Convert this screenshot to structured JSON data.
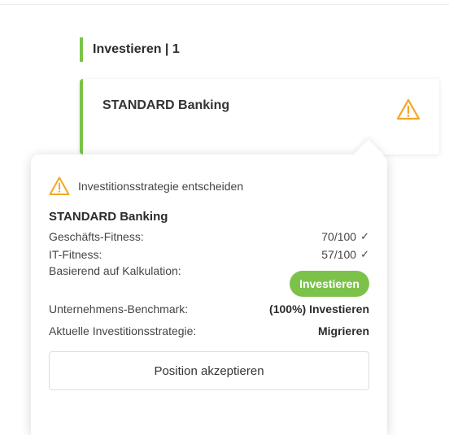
{
  "section": {
    "header": "Investieren | 1"
  },
  "card": {
    "title": "STANDARD Banking",
    "warning_icon": "warning-triangle-icon"
  },
  "popover": {
    "header": "Investitionsstrategie entscheiden",
    "title": "STANDARD Banking",
    "business_fitness_label": "Geschäfts-Fitness:",
    "business_fitness_value": "70/100",
    "it_fitness_label": "IT-Fitness:",
    "it_fitness_value": "57/100",
    "check_glyph": "✓",
    "basis_label": "Basierend auf Kalkulation:",
    "basis_value": "Investieren",
    "benchmark_label": "Unternehmens-Benchmark:",
    "benchmark_value": "(100%) Investieren",
    "current_strategy_label": "Aktuelle Investitionsstrategie:",
    "current_strategy_value": "Migrieren",
    "accept_button": "Position akzeptieren"
  },
  "colors": {
    "accent_green": "#7cc24a",
    "warning_orange": "#f5a623"
  }
}
